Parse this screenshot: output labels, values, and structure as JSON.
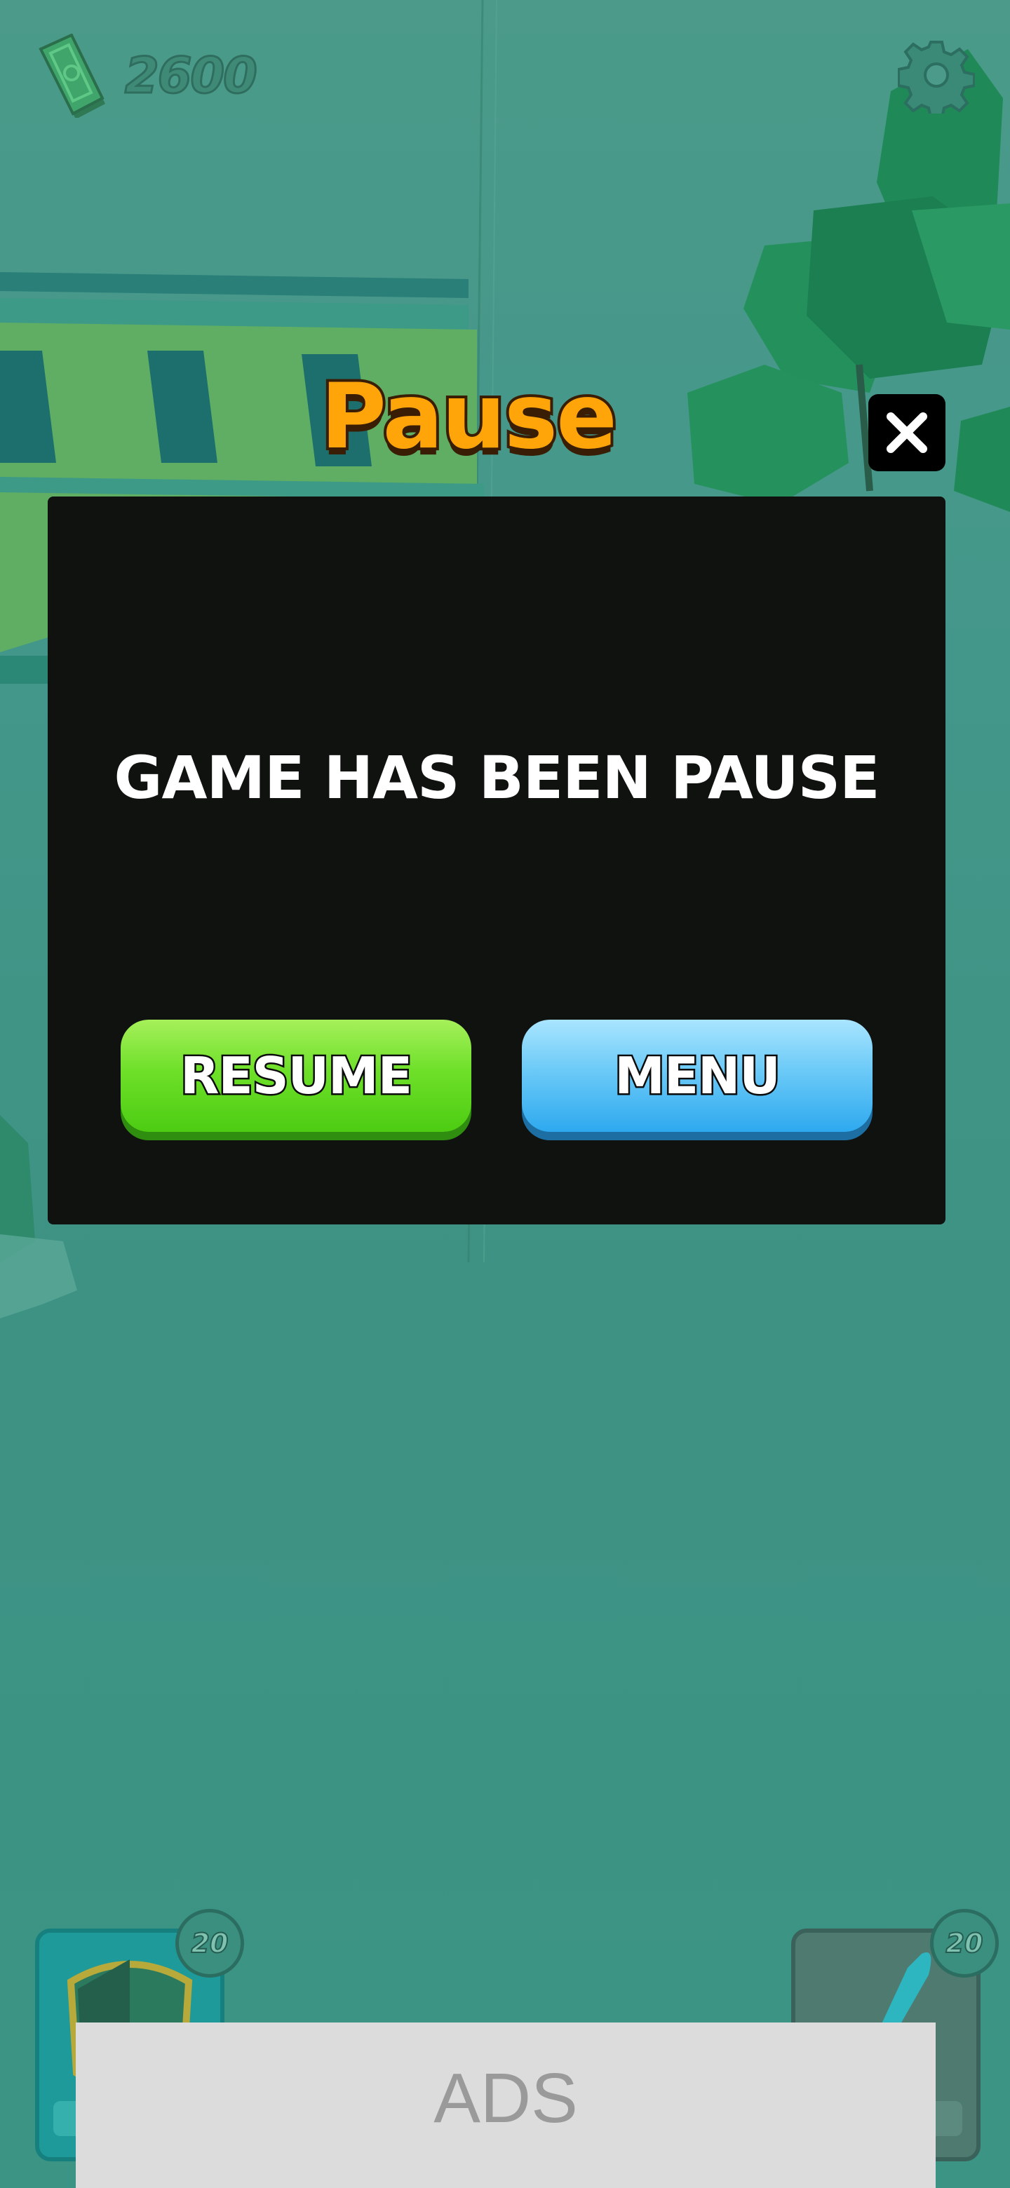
{
  "hud": {
    "cash_icon": "cash-icon",
    "cash_value": "2600",
    "settings_icon": "gear-icon"
  },
  "pause_dialog": {
    "title": "Pause",
    "close_icon": "close-icon",
    "message": "GAME HAS BEEN PAUSE",
    "resume_label": "RESUME",
    "menu_label": "MENU"
  },
  "items": [
    {
      "icon": "shield-icon",
      "count": "20"
    },
    {
      "icon": "sword-icon",
      "count": "20"
    }
  ],
  "ads": {
    "label": "ADS"
  },
  "colors": {
    "background": "#43978a",
    "dialog": "#101210",
    "title": "#ffa50a",
    "resume": "#6fe02a",
    "menu": "#6ccaf7",
    "ads": "#dcdcdc"
  }
}
